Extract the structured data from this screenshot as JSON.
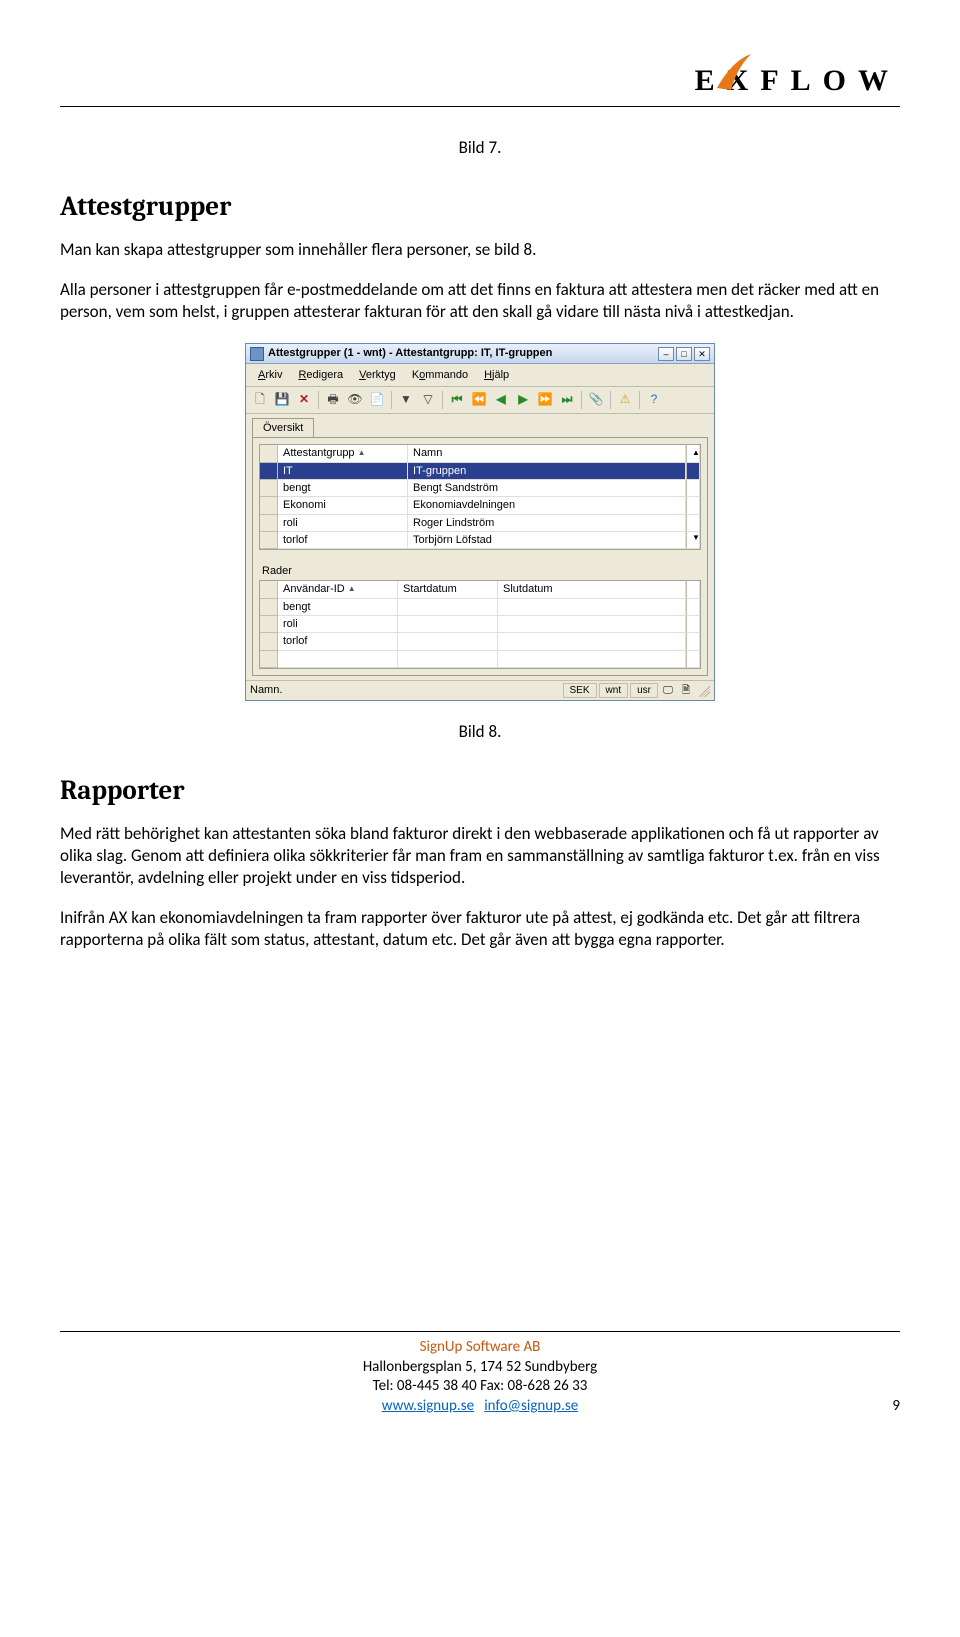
{
  "logo": {
    "text": "EXFLOW"
  },
  "bild7": "Bild 7.",
  "h_attestgrupper": "Attestgrupper",
  "p_attest1": "Man kan skapa attestgrupper som innehåller flera personer, se bild 8.",
  "p_attest2": "Alla personer i attestgruppen får e-postmeddelande om att det finns en faktura att attestera men det räcker med att en person, vem som helst, i gruppen attesterar fakturan för att den skall gå vidare till nästa nivå i attestkedjan.",
  "win": {
    "title": "Attestgrupper (1 - wnt) - Attestantgrupp: IT, IT-gruppen",
    "menu": {
      "arkiv": "Arkiv",
      "redigera": "Redigera",
      "verktyg": "Verktyg",
      "kommando": "Kommando",
      "hjalp": "Hjälp"
    },
    "tab_oversikt": "Översikt",
    "grid1": {
      "h1": "Attestantgrupp",
      "h2": "Namn",
      "rows": [
        {
          "a": "IT",
          "b": "IT-gruppen",
          "sel": true
        },
        {
          "a": "bengt",
          "b": "Bengt Sandström"
        },
        {
          "a": "Ekonomi",
          "b": "Ekonomiavdelningen"
        },
        {
          "a": "roli",
          "b": "Roger Lindström"
        },
        {
          "a": "torlof",
          "b": "Torbjörn Löfstad"
        }
      ]
    },
    "rader_label": "Rader",
    "grid2": {
      "h1": "Användar-ID",
      "h2": "Startdatum",
      "h3": "Slutdatum",
      "rows": [
        {
          "a": "bengt"
        },
        {
          "a": "roli"
        },
        {
          "a": "torlof"
        },
        {
          "a": ""
        }
      ]
    },
    "status": {
      "left": "Namn.",
      "sek": "SEK",
      "wnt": "wnt",
      "usr": "usr"
    }
  },
  "bild8": "Bild 8.",
  "h_rapporter": "Rapporter",
  "p_rap1": "Med rätt behörighet kan attestanten söka bland fakturor direkt i den webbaserade applikationen och få ut rapporter av olika slag. Genom att definiera olika sökkriterier får man fram en sammanställning av samtliga fakturor t.ex. från en viss leverantör, avdelning eller projekt under en viss tidsperiod.",
  "p_rap2": "Inifrån AX kan ekonomiavdelningen ta fram rapporter över fakturor ute på attest, ej godkända etc. Det går att filtrera rapporterna på olika fält som status, attestant, datum etc. Det går även att bygga egna rapporter.",
  "footer": {
    "company": "SignUp Software AB",
    "addr": "Hallonbergsplan 5, 174 52 Sundbyberg",
    "tel": "Tel: 08-445 38 40  Fax: 08-628 26 33",
    "l1": "www.signup.se",
    "l2": "info@signup.se",
    "page": "9"
  }
}
